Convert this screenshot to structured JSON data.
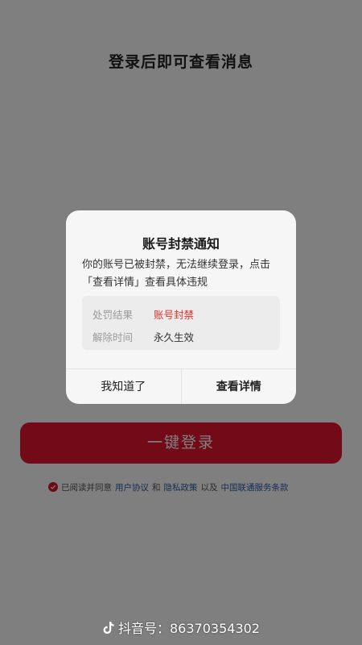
{
  "page": {
    "title": "登录后即可查看消息"
  },
  "login": {
    "button_label": "一键登录"
  },
  "agreement": {
    "prefix": "已阅读并同意",
    "user_agreement": "用户协议",
    "and": "和",
    "privacy_policy": "隐私政策",
    "also": "以及",
    "unicom_terms": "中国联通服务条款",
    "checked": true
  },
  "dialog": {
    "title": "账号封禁通知",
    "message": "你的账号已被封禁，无法继续登录，点击「查看详情」查看具体违规",
    "rows": [
      {
        "label": "处罚结果",
        "value": "账号封禁"
      },
      {
        "label": "解除时间",
        "value": "永久生效"
      }
    ],
    "dismiss_label": "我知道了",
    "details_label": "查看详情"
  },
  "watermark": {
    "text": "抖音号：86370354302",
    "icon": "tiktok-icon"
  },
  "colors": {
    "accent": "#e5162f",
    "penalty_red": "#e0322b",
    "link_blue": "#2d5fa8",
    "overlay": "rgba(0,0,0,0.5)"
  }
}
